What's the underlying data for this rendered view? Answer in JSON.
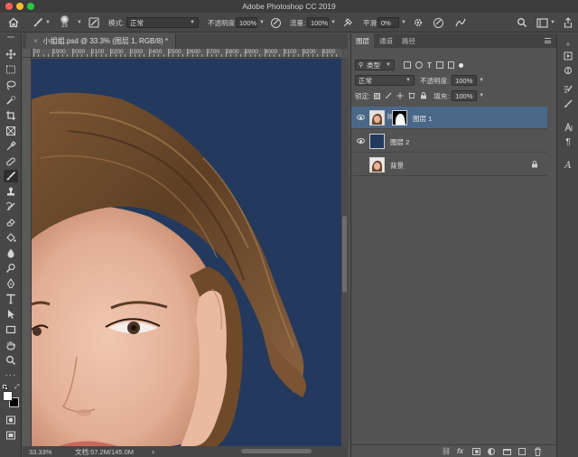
{
  "window": {
    "title": "Adobe Photoshop CC 2019",
    "traffic_colors": [
      "#ff5f57",
      "#febc2e",
      "#28c840"
    ]
  },
  "options_bar": {
    "brush_size": "25",
    "mode_label": "模式:",
    "mode_value": "正常",
    "opacity_label": "不透明度:",
    "opacity_value": "100%",
    "flow_label": "流量:",
    "flow_value": "100%",
    "smoothing_label": "平滑:",
    "smoothing_value": "0%"
  },
  "document_tab": {
    "label": "小姐姐.psd @ 33.3% (图层 1, RGB/8) *",
    "close": "×"
  },
  "ruler": {
    "ticks": [
      "00",
      "1900",
      "2000",
      "2100",
      "2200",
      "2300",
      "2400",
      "2500",
      "2600",
      "2700",
      "2800",
      "2900",
      "3000",
      "3100",
      "3200",
      "3300"
    ]
  },
  "canvas": {
    "background_color": "#23395e"
  },
  "status_bar": {
    "zoom": "33.33%",
    "doc_info": "文档:57.2M/145.0M",
    "arrow": "›"
  },
  "panel": {
    "tabs": [
      "图层",
      "通道",
      "路径"
    ],
    "active_tab": "图层",
    "filter_label": "类型",
    "blend_mode": "正常",
    "opacity_label": "不透明度:",
    "opacity_value": "100%",
    "lock_label": "锁定:",
    "fill_label": "填充:",
    "fill_value": "100%",
    "layers": [
      {
        "name": "图层 1",
        "selected": true,
        "visible": true
      },
      {
        "name": "图层 2",
        "selected": false,
        "visible": true
      },
      {
        "name": "背景",
        "selected": false,
        "visible": false
      }
    ],
    "bottom_icons": [
      "link-icon",
      "fx-icon",
      "mask-icon",
      "adjustment-icon",
      "group-icon",
      "new-layer-icon",
      "trash-icon"
    ],
    "fx_label": "fx"
  },
  "colors": {
    "selection_blue": "#4a6788",
    "hair_brown": "#6b4a2c",
    "skin": "#e6b59e"
  }
}
